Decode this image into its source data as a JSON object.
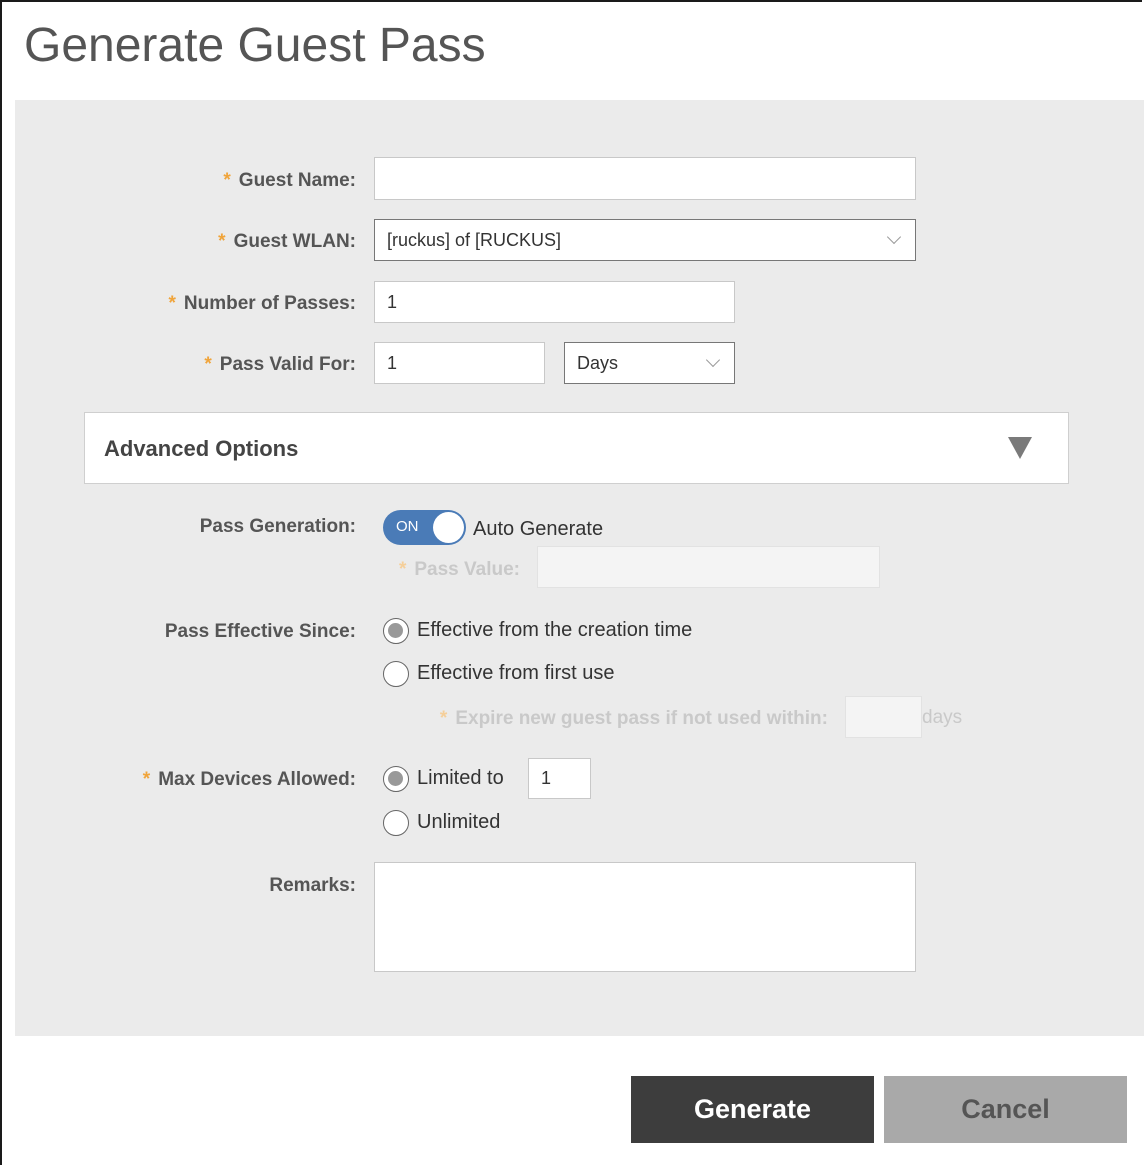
{
  "dialog": {
    "title": "Generate Guest Pass"
  },
  "form": {
    "guest_name": {
      "label": "Guest Name:",
      "required": "*",
      "value": ""
    },
    "guest_wlan": {
      "label": "Guest WLAN:",
      "required": "*",
      "value": "[ruckus] of [RUCKUS]"
    },
    "number_of_passes": {
      "label": "Number of Passes:",
      "required": "*",
      "value": "1"
    },
    "pass_valid_for": {
      "label": "Pass Valid For:",
      "required": "*",
      "value": "1",
      "unit": "Days"
    }
  },
  "advanced": {
    "title": "Advanced Options",
    "pass_generation": {
      "label": "Pass Generation:",
      "toggle_state": "ON",
      "toggle_text": "Auto Generate",
      "pass_value_label": "Pass Value:",
      "pass_value_required": "*",
      "pass_value": ""
    },
    "pass_effective_since": {
      "label": "Pass Effective Since:",
      "options": [
        "Effective from the creation time",
        "Effective from first use"
      ],
      "selected": 0,
      "expire_label": "Expire new guest pass if not used within:",
      "expire_required": "*",
      "expire_value": "",
      "expire_unit": "days"
    },
    "max_devices": {
      "label": "Max Devices Allowed:",
      "required": "*",
      "options": [
        "Limited to",
        "Unlimited"
      ],
      "selected": 0,
      "limit_value": "1"
    },
    "remarks": {
      "label": "Remarks:",
      "value": ""
    }
  },
  "buttons": {
    "generate": "Generate",
    "cancel": "Cancel"
  }
}
